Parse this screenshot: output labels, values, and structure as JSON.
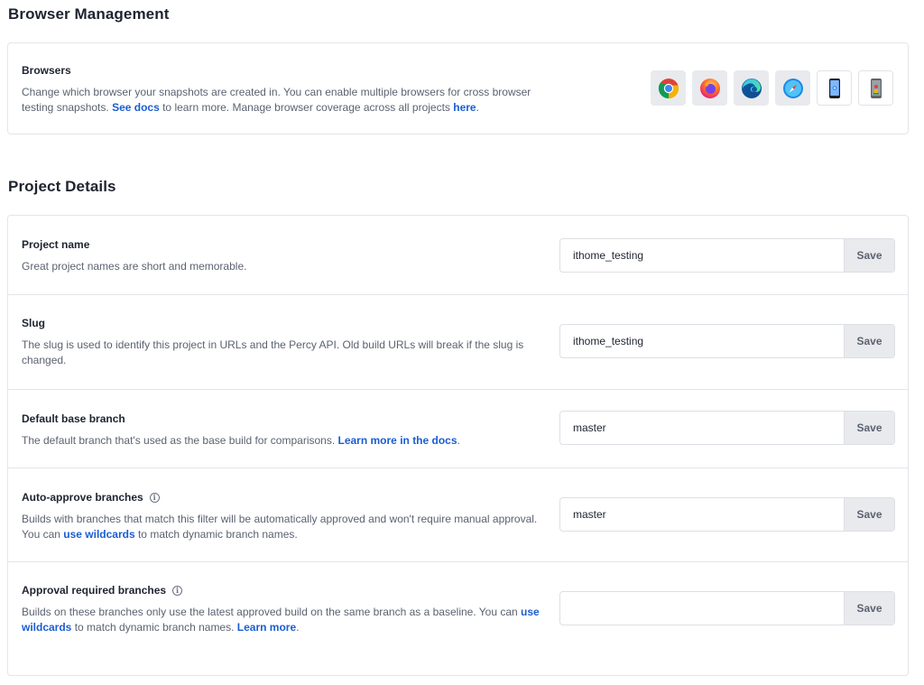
{
  "browser_management": {
    "heading": "Browser Management",
    "browsers": {
      "title": "Browsers",
      "desc_1": "Change which browser your snapshots are created in. You can enable multiple browsers for cross browser testing snapshots. ",
      "see_docs": "See docs",
      "desc_2": " to learn more. Manage browser coverage across all projects ",
      "here": "here",
      "desc_3": ".",
      "items": [
        {
          "name": "chrome-icon",
          "enabled": true
        },
        {
          "name": "firefox-icon",
          "enabled": true
        },
        {
          "name": "edge-icon",
          "enabled": true
        },
        {
          "name": "safari-icon",
          "enabled": true
        },
        {
          "name": "mobile-ios-icon",
          "enabled": false
        },
        {
          "name": "mobile-android-icon",
          "enabled": false
        }
      ]
    }
  },
  "project_details": {
    "heading": "Project Details",
    "save_label": "Save",
    "project_name": {
      "title": "Project name",
      "desc": "Great project names are short and memorable.",
      "value": "ithome_testing"
    },
    "slug": {
      "title": "Slug",
      "desc": "The slug is used to identify this project in URLs and the Percy API. Old build URLs will break if the slug is changed.",
      "value": "ithome_testing"
    },
    "default_base_branch": {
      "title": "Default base branch",
      "desc_1": "The default branch that's used as the base build for comparisons. ",
      "link": "Learn more in the docs",
      "desc_2": ".",
      "value": "master"
    },
    "auto_approve": {
      "title": "Auto-approve branches",
      "desc_1": "Builds with branches that match this filter will be automatically approved and won't require manual approval. You can ",
      "link": "use wildcards",
      "desc_2": " to match dynamic branch names.",
      "value": "master"
    },
    "approval_required": {
      "title": "Approval required branches",
      "desc_1": "Builds on these branches only use the latest approved build on the same branch as a baseline. You can ",
      "link_1": "use wildcards",
      "desc_2": " to match dynamic branch names. ",
      "link_2": "Learn more",
      "desc_3": ".",
      "value": ""
    }
  },
  "colors": {
    "link": "#1a5dd3",
    "save_bg": "#e9eaed",
    "border": "#e3e5ea",
    "text_muted": "#5b6270"
  }
}
